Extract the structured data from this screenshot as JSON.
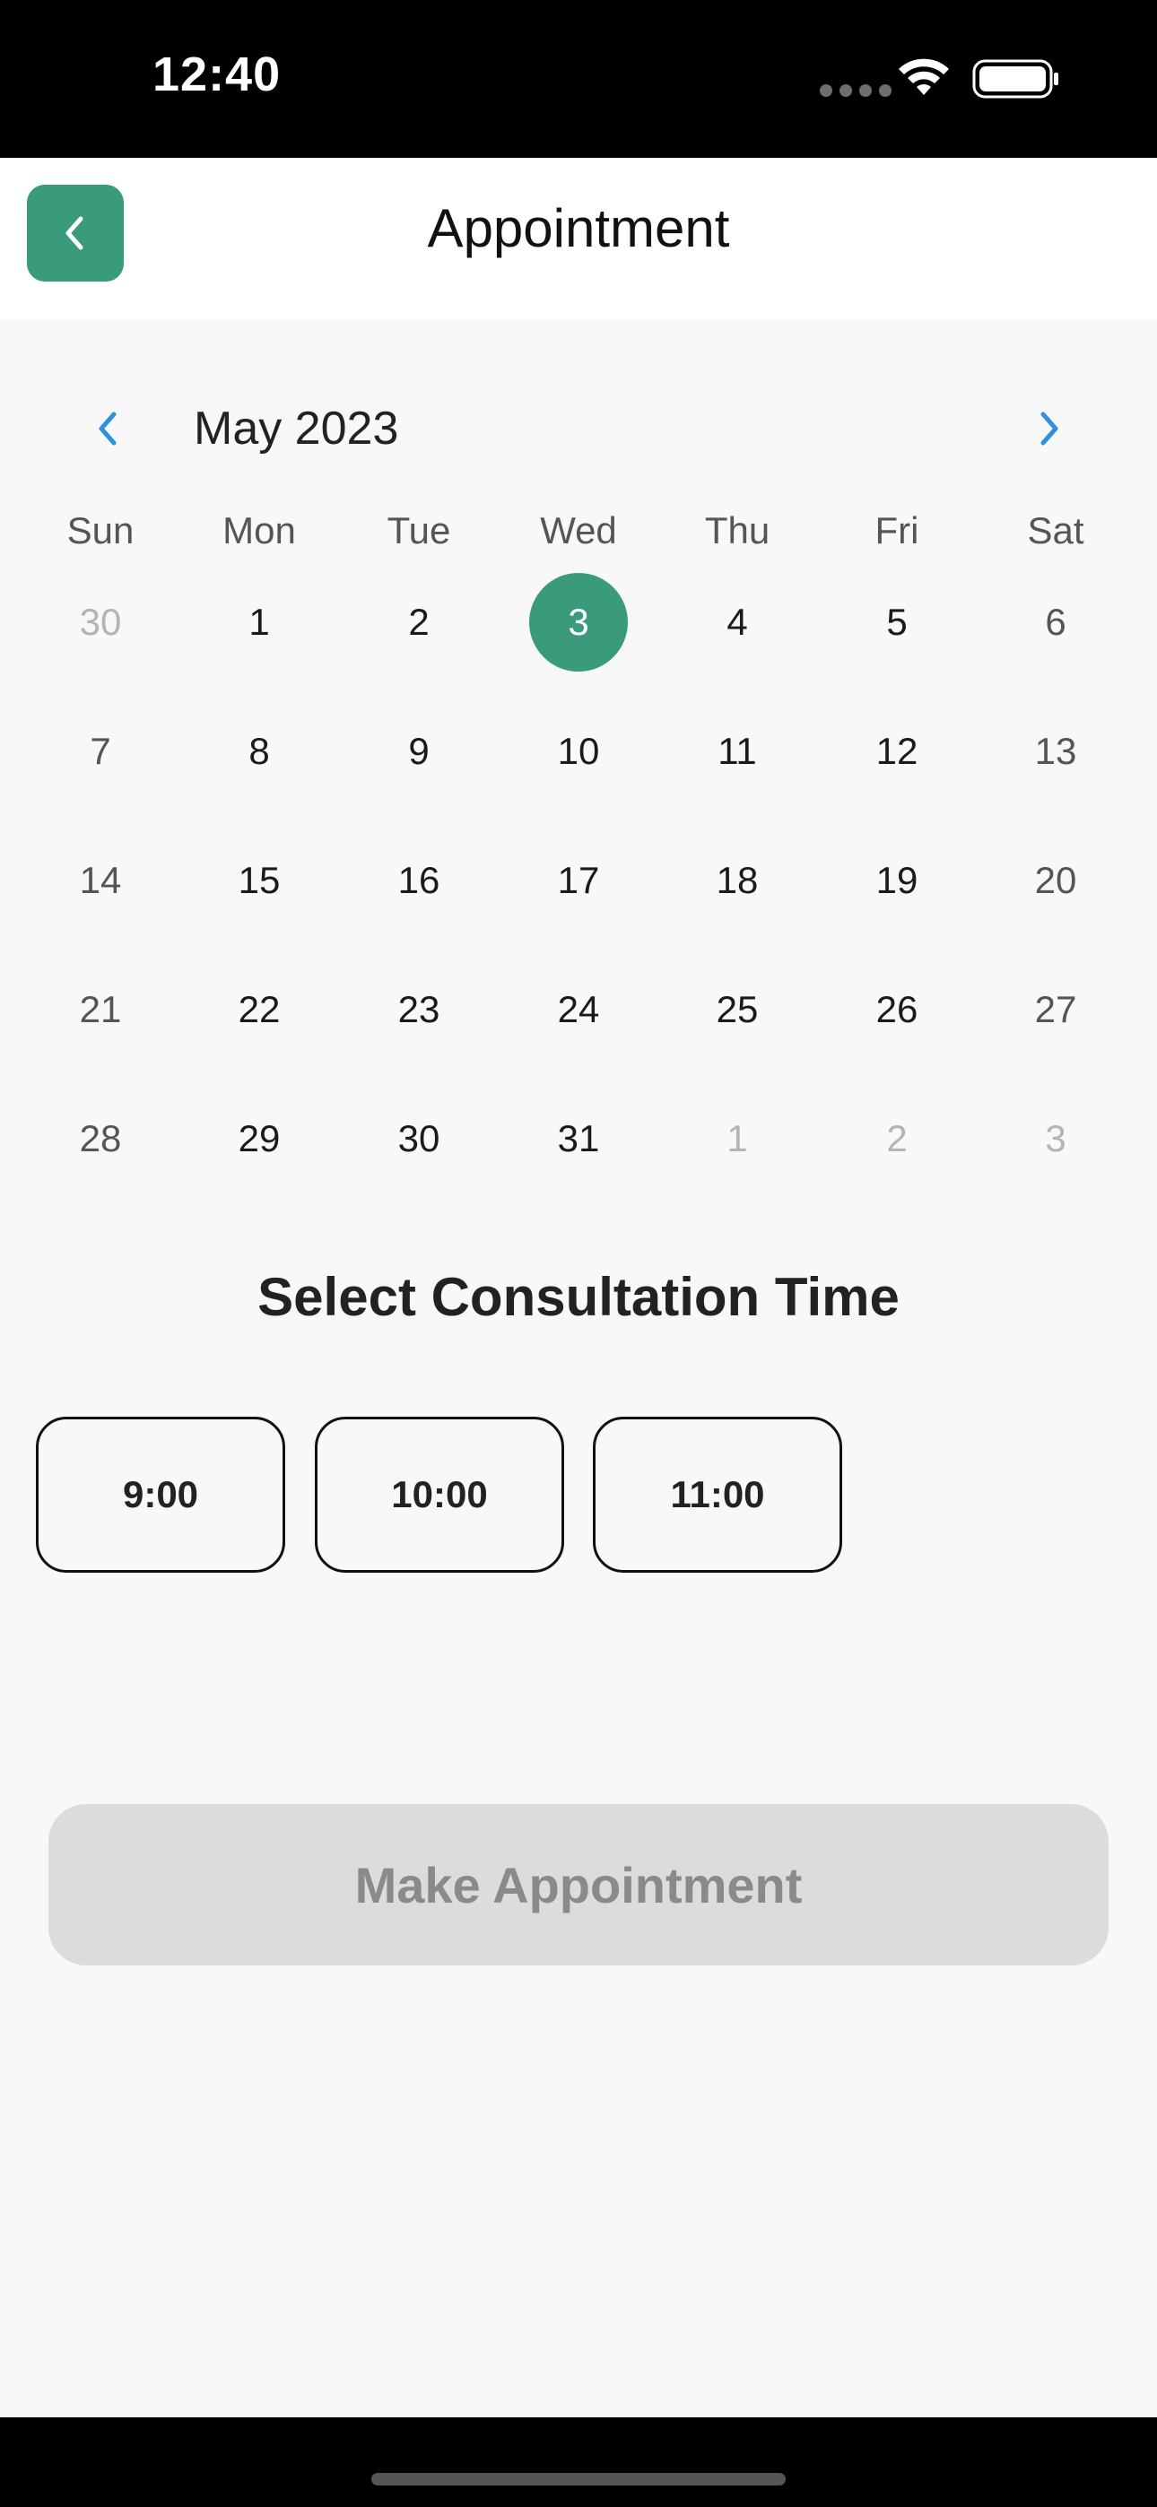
{
  "status_bar": {
    "time": "12:40",
    "icons": [
      "signal-dots-icon",
      "wifi-icon",
      "battery-icon"
    ]
  },
  "nav": {
    "title": "Appointment",
    "back_icon": "chevron-left-icon"
  },
  "calendar": {
    "month_label": "May 2023",
    "weekdays": [
      "Sun",
      "Mon",
      "Tue",
      "Wed",
      "Thu",
      "Fri",
      "Sat"
    ],
    "weeks": [
      [
        {
          "d": "30",
          "state": "outside"
        },
        {
          "d": "1",
          "state": "in"
        },
        {
          "d": "2",
          "state": "in"
        },
        {
          "d": "3",
          "state": "selected"
        },
        {
          "d": "4",
          "state": "in"
        },
        {
          "d": "5",
          "state": "in"
        },
        {
          "d": "6",
          "state": "in"
        }
      ],
      [
        {
          "d": "7",
          "state": "in"
        },
        {
          "d": "8",
          "state": "in"
        },
        {
          "d": "9",
          "state": "in"
        },
        {
          "d": "10",
          "state": "in"
        },
        {
          "d": "11",
          "state": "in"
        },
        {
          "d": "12",
          "state": "in"
        },
        {
          "d": "13",
          "state": "in"
        }
      ],
      [
        {
          "d": "14",
          "state": "in"
        },
        {
          "d": "15",
          "state": "in"
        },
        {
          "d": "16",
          "state": "in"
        },
        {
          "d": "17",
          "state": "in"
        },
        {
          "d": "18",
          "state": "in"
        },
        {
          "d": "19",
          "state": "in"
        },
        {
          "d": "20",
          "state": "in"
        }
      ],
      [
        {
          "d": "21",
          "state": "in"
        },
        {
          "d": "22",
          "state": "in"
        },
        {
          "d": "23",
          "state": "in"
        },
        {
          "d": "24",
          "state": "in"
        },
        {
          "d": "25",
          "state": "in"
        },
        {
          "d": "26",
          "state": "in"
        },
        {
          "d": "27",
          "state": "in"
        }
      ],
      [
        {
          "d": "28",
          "state": "in"
        },
        {
          "d": "29",
          "state": "in"
        },
        {
          "d": "30",
          "state": "in"
        },
        {
          "d": "31",
          "state": "in"
        },
        {
          "d": "1",
          "state": "outside"
        },
        {
          "d": "2",
          "state": "outside"
        },
        {
          "d": "3",
          "state": "outside"
        }
      ]
    ],
    "selected_day": "3",
    "accent_color": "#3a9a7c",
    "nav_arrow_color": "#2f8fe0"
  },
  "consultation": {
    "title": "Select Consultation Time",
    "slots": [
      "9:00",
      "10:00",
      "11:00"
    ]
  },
  "actions": {
    "make_appointment_label": "Make Appointment",
    "make_appointment_state": "disabled"
  }
}
